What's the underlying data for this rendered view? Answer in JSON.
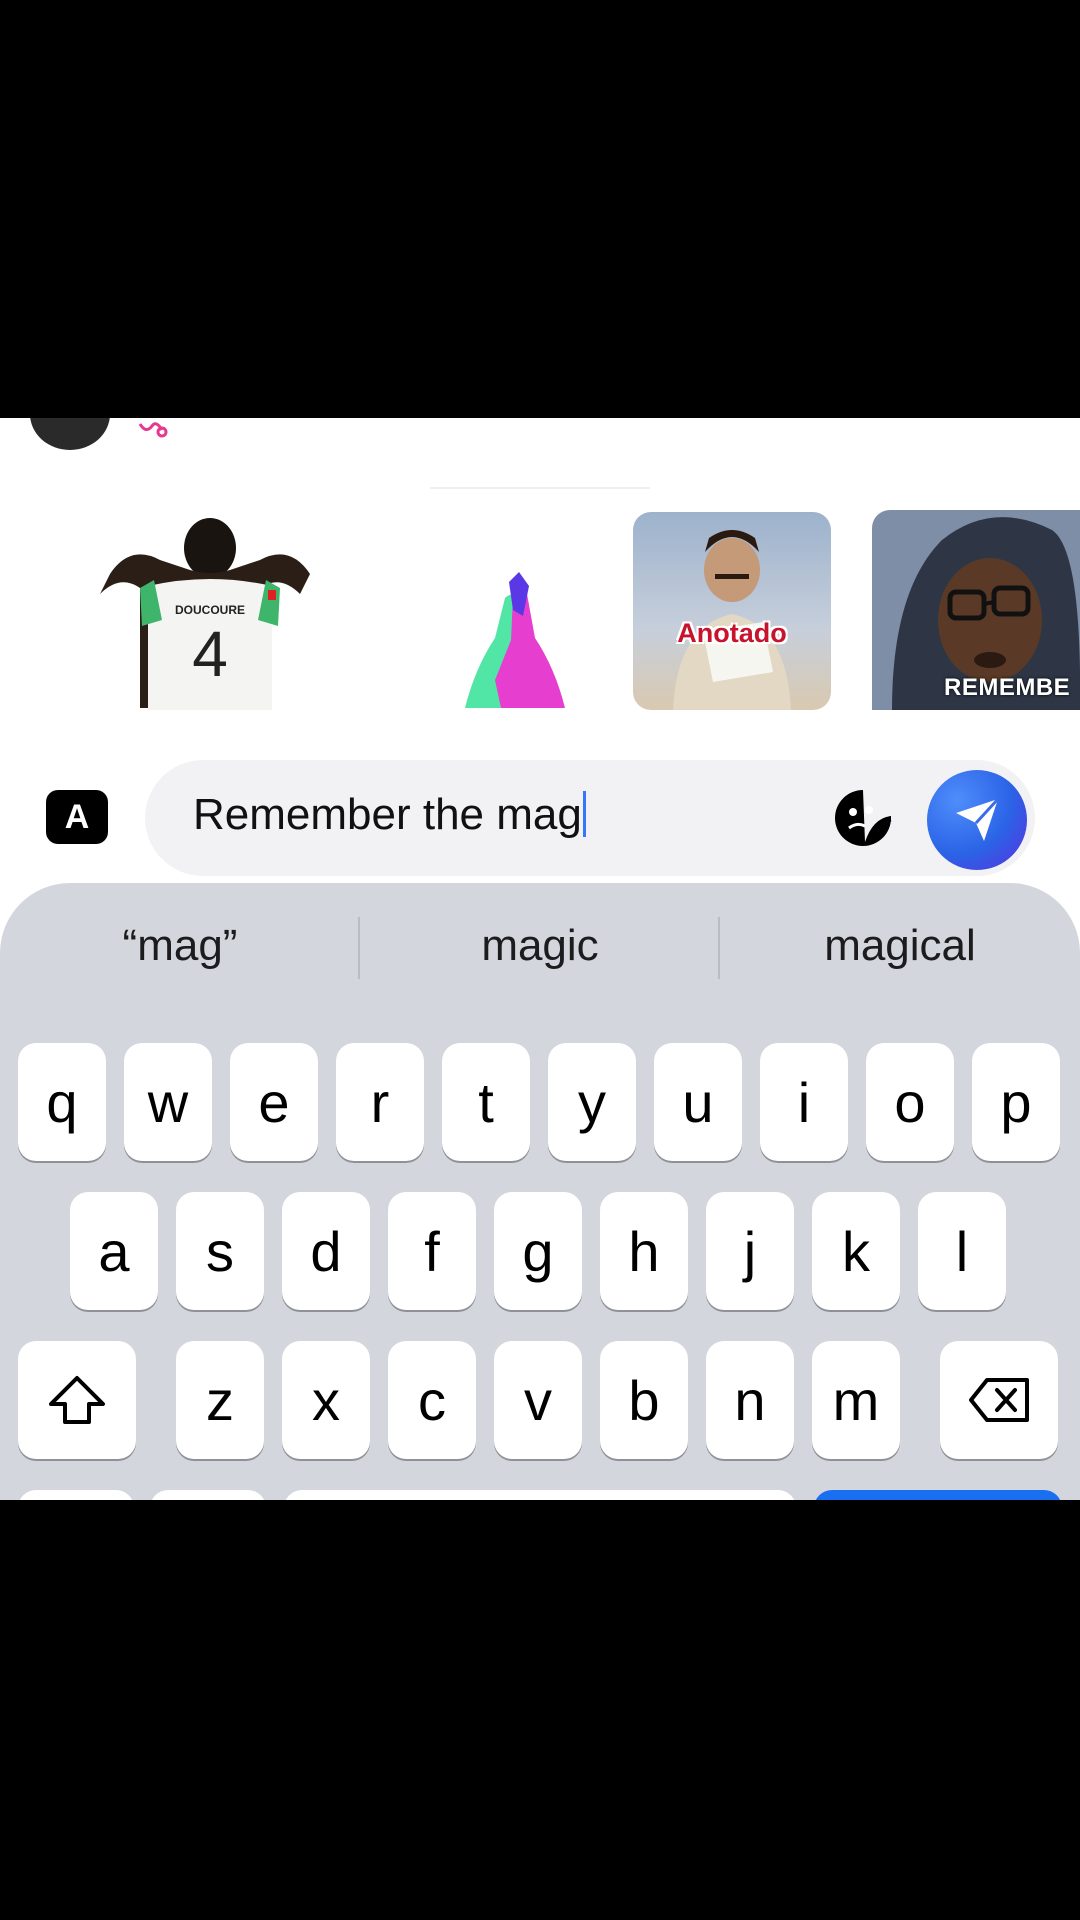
{
  "stickers": {
    "items": [
      {
        "name": "player-jersey",
        "label": ""
      },
      {
        "name": "high-five",
        "label": ""
      },
      {
        "name": "anotado",
        "label": "Anotado"
      },
      {
        "name": "remember",
        "label": "REMEMBE"
      }
    ]
  },
  "composer": {
    "apps_label": "A",
    "text": "Remember the mag",
    "sticker_icon": "sticker-face-icon",
    "send_icon": "send-paper-plane-icon",
    "send_color": "#2b63e6"
  },
  "keyboard": {
    "suggestions": [
      "“mag”",
      "magic",
      "magical"
    ],
    "row1": [
      "q",
      "w",
      "e",
      "r",
      "t",
      "y",
      "u",
      "i",
      "o",
      "p"
    ],
    "row2": [
      "a",
      "s",
      "d",
      "f",
      "g",
      "h",
      "j",
      "k",
      "l"
    ],
    "row3": [
      "z",
      "x",
      "c",
      "v",
      "b",
      "n",
      "m"
    ],
    "shift_icon": "shift-arrow-icon",
    "delete_icon": "backspace-icon"
  }
}
